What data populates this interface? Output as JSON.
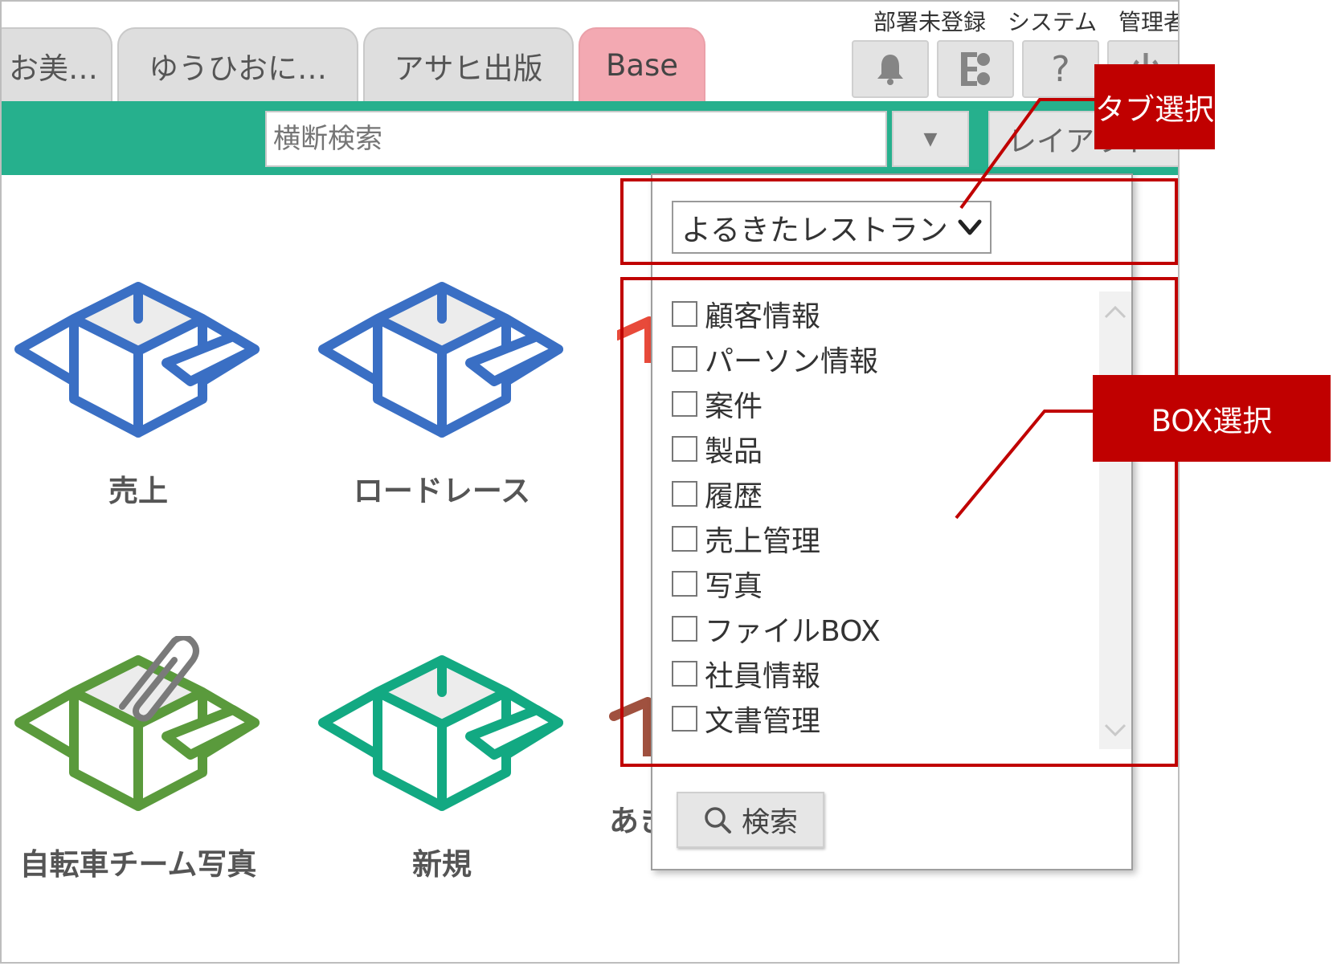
{
  "tabs": [
    {
      "label": "お美…",
      "active": false
    },
    {
      "label": "ゆうひおに…",
      "active": false
    },
    {
      "label": "アサヒ出版",
      "active": false
    },
    {
      "label": "Base",
      "active": true
    }
  ],
  "header": {
    "department": "部署未登録",
    "user": "システム 管理者",
    "buttons": [
      {
        "icon": "bell-icon"
      },
      {
        "icon": "org-chart-icon"
      },
      {
        "icon": "help-icon",
        "text": "?"
      },
      {
        "icon": "power-icon"
      }
    ]
  },
  "toolbar": {
    "search_placeholder": "横断検索",
    "layout_label": "レイアウト"
  },
  "tiles": [
    {
      "label": "売上",
      "color": "#3a6fc4",
      "icon": "box-icon"
    },
    {
      "label": "ロードレース",
      "color": "#3a6fc4",
      "icon": "box-icon"
    },
    {
      "label": "自転車チーム写真",
      "color": "#5a9a3c",
      "icon": "box-clip-icon"
    },
    {
      "label": "新規",
      "color": "#12a982",
      "icon": "box-icon"
    },
    {
      "label": "あきさた日報率",
      "color": "#a0513f",
      "icon": "box-icon"
    }
  ],
  "popup": {
    "tab_select_value": "よるきたレストラン",
    "boxes": [
      {
        "label": "顧客情報",
        "checked": false
      },
      {
        "label": "パーソン情報",
        "checked": false
      },
      {
        "label": "案件",
        "checked": false
      },
      {
        "label": "製品",
        "checked": false
      },
      {
        "label": "履歴",
        "checked": false
      },
      {
        "label": "売上管理",
        "checked": false
      },
      {
        "label": "写真",
        "checked": false
      },
      {
        "label": "ファイルBOX",
        "checked": false
      },
      {
        "label": "社員情報",
        "checked": false
      },
      {
        "label": "文書管理",
        "checked": false
      }
    ],
    "search_label": "検索"
  },
  "annotations": {
    "tab_select": "タブ選択",
    "box_select": "BOX選択",
    "color": "#c00000"
  }
}
